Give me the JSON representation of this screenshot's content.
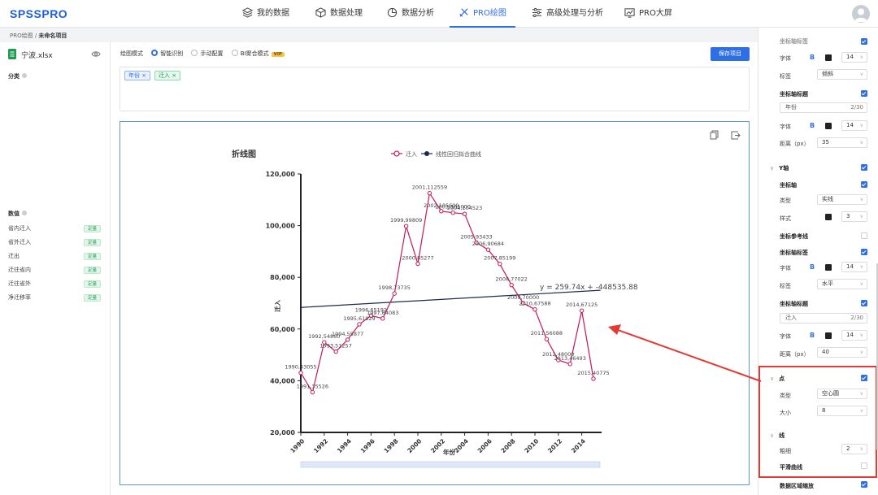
{
  "app": {
    "logo": "SPSSPRO"
  },
  "nav": [
    {
      "label": "我的数据",
      "icon": "layers-icon"
    },
    {
      "label": "数据处理",
      "icon": "cube-icon"
    },
    {
      "label": "数据分析",
      "icon": "pie-chart-icon"
    },
    {
      "label": "PRO绘图",
      "icon": "draw-tools-icon",
      "active": true
    },
    {
      "label": "高级处理与分析",
      "icon": "sliders-icon"
    },
    {
      "label": "PRO大屏",
      "icon": "dashboard-icon"
    }
  ],
  "breadcrumb": {
    "root": "PRO绘图",
    "sep": " / ",
    "current": "未命名项目"
  },
  "left": {
    "file_name": "宁波.xlsx",
    "category_label": "分类",
    "numeric_label": "数值",
    "variables": [
      {
        "name": "省内迁入",
        "tag": "定量"
      },
      {
        "name": "省外迁入",
        "tag": "定量"
      },
      {
        "name": "迁出",
        "tag": "定量"
      },
      {
        "name": "迁往省内",
        "tag": "定量"
      },
      {
        "name": "迁往省外",
        "tag": "定量"
      },
      {
        "name": "净迁移率",
        "tag": "定量"
      }
    ]
  },
  "toolbar": {
    "mode_label": "绘图模式",
    "modes": [
      "智能识别",
      "手动配置",
      "BI聚合模式"
    ],
    "vip": "VIP",
    "save_label": "保存项目"
  },
  "fields": {
    "x": "年份",
    "y": "迁入",
    "remove": "×"
  },
  "chart_data": {
    "type": "line",
    "title": "折线图",
    "xlabel": "年份",
    "ylabel": "迁入",
    "x": [
      1990,
      1991,
      1992,
      1993,
      1994,
      1995,
      1996,
      1997,
      1998,
      1999,
      2000,
      2001,
      2002,
      2003,
      2004,
      2005,
      2006,
      2007,
      2008,
      2009,
      2010,
      2011,
      2012,
      2013,
      2014,
      2015
    ],
    "series": [
      {
        "name": "迁入",
        "color": "#c2185b",
        "values": [
          43055,
          35526,
          54860,
          51257,
          55877,
          61829,
          65192,
          64083,
          73735,
          99809,
          85277,
          112559,
          105600,
          105000,
          104523,
          93433,
          90684,
          85199,
          77022,
          70000,
          67588,
          56088,
          48000,
          46493,
          67125,
          40775
        ],
        "labels": [
          "1990,43055",
          "1991,35526",
          "1992,54860",
          "1993,51257",
          "1994,55877",
          "1995,61829",
          "1996,65192",
          "1997,64083",
          "1998,73735",
          "1999,99809",
          "2000,85277",
          "2001,112559",
          "2002,105600",
          "2003,105000",
          "2004,104523",
          "2005,93433",
          "2006,90684",
          "2007,85199",
          "2008,77022",
          "2009,70000",
          "2010,67588",
          "2011,56088",
          "2012,48000",
          "2013,46493",
          "2014,67125",
          "2015,40775"
        ]
      },
      {
        "name": "线性回归拟合曲线",
        "color": "#1a2a4f",
        "slope": 259.74,
        "intercept": -448535.88
      }
    ],
    "equation": "y = 259.74x + -448535.88",
    "xticks": [
      "1990",
      "1992",
      "1994",
      "1996",
      "1998",
      "2000",
      "2002",
      "2004",
      "2006",
      "2008",
      "2010",
      "2012",
      "2014"
    ],
    "yticks": [
      "20,000",
      "40,000",
      "60,000",
      "80,000",
      "100,000",
      "120,000"
    ],
    "ylim": [
      20000,
      120000
    ],
    "xlim": [
      1990,
      2015
    ],
    "legend": "top-center"
  },
  "right": {
    "items": {
      "axis_label_top": "坐标轴标签",
      "font": "字体",
      "font_bold": "B",
      "font_size": "14",
      "label": "标签",
      "label_tilt": "倾斜",
      "axis_title": "坐标轴标题",
      "x_title_value": "年份",
      "count_x": "2/30",
      "distance": "距离（px）",
      "distance_x": "35",
      "y_axis": "Y轴",
      "axis_line": "坐标轴",
      "type": "类型",
      "solid": "实线",
      "style": "样式",
      "style_width": "3",
      "ref_line": "坐标参考线",
      "label_horizontal": "水平",
      "y_title_value": "迁入",
      "count_y": "2/30",
      "distance_y": "40",
      "point": "点",
      "point_type": "空心圆",
      "size": "大小",
      "size_value": "8",
      "line": "线",
      "thickness": "粗细",
      "thickness_value": "2",
      "smooth": "平滑曲线",
      "zoom": "数据区域缩放"
    }
  },
  "colors": {
    "accent": "#2f6fe6",
    "line": "#c2185b",
    "fit": "#1a2a4f",
    "highlight": "#e53935",
    "tag": "#26a65b"
  }
}
